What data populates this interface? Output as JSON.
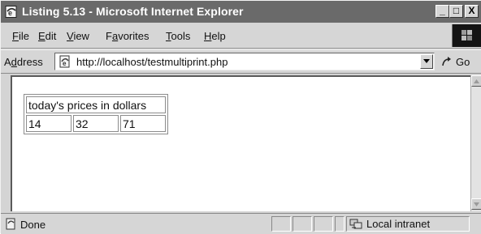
{
  "window": {
    "title": "Listing 5.13 - Microsoft Internet Explorer",
    "buttons": {
      "minimize": "_",
      "maximize": "□",
      "close": "X"
    }
  },
  "menu": [
    {
      "accel": "F",
      "rest": "ile"
    },
    {
      "accel": "E",
      "rest": "dit"
    },
    {
      "accel": "V",
      "rest": "iew"
    },
    {
      "pre": "F",
      "accel": "a",
      "rest": "vorites"
    },
    {
      "accel": "T",
      "rest": "ools"
    },
    {
      "accel": "H",
      "rest": "elp"
    }
  ],
  "address": {
    "label_pre": "A",
    "label_accel": "d",
    "label_rest": "dress",
    "url": "http://localhost/testmultiprint.php",
    "go_label": "Go"
  },
  "page": {
    "table_header": "today's prices in dollars",
    "prices": [
      "14",
      "32",
      "71"
    ]
  },
  "status": {
    "text": "Done",
    "zone": "Local intranet"
  },
  "icons": {
    "app": "ie-page-icon",
    "page": "ie-page-icon",
    "go": "go-arrow-icon",
    "status": "page-done-icon",
    "zone": "local-intranet-icon"
  }
}
